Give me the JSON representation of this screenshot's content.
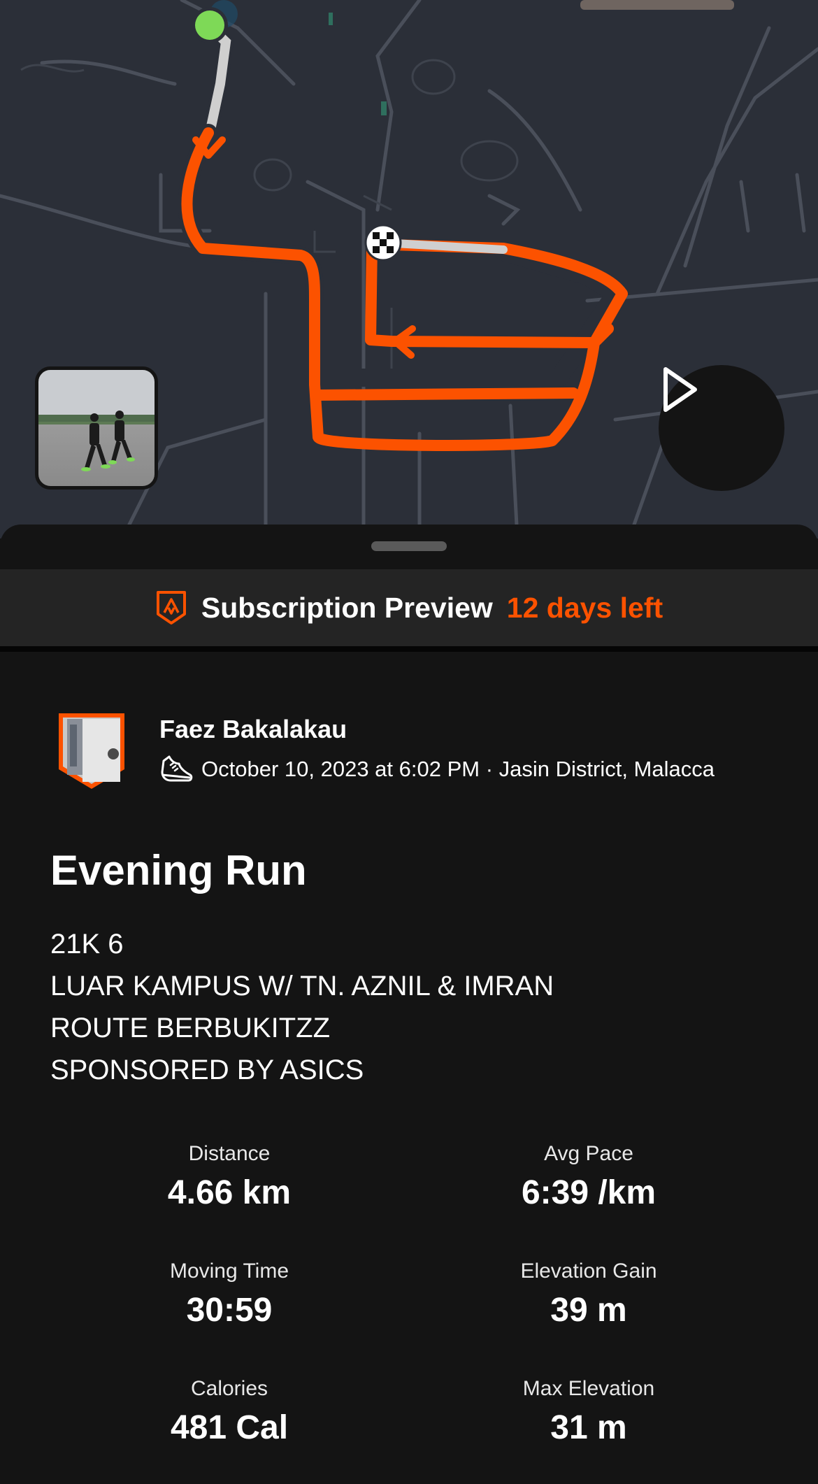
{
  "map": {
    "route_color": "#fc5200",
    "start_marker_color": "#7ed957",
    "start_marker": "start-dot-icon",
    "finish_marker": "checkered-flag-icon"
  },
  "play_button": {
    "icon": "play-icon"
  },
  "subscription": {
    "title": "Subscription Preview",
    "days_left": "12 days left",
    "accent": "#fc5200"
  },
  "athlete": {
    "name": "Faez Bakalakau",
    "meta": "October 10, 2023 at 6:02 PM · Jasin District, Malacca",
    "activity_icon": "running-shoe-icon"
  },
  "activity": {
    "title": "Evening Run",
    "description_lines": [
      "21K 6",
      "LUAR KAMPUS W/ TN. AZNIL & IMRAN",
      "ROUTE BERBUKITZZ",
      "SPONSORED BY ASICS"
    ]
  },
  "stats": [
    {
      "label": "Distance",
      "value": "4.66 km"
    },
    {
      "label": "Avg Pace",
      "value": "6:39 /km"
    },
    {
      "label": "Moving Time",
      "value": "30:59"
    },
    {
      "label": "Elevation Gain",
      "value": "39 m"
    },
    {
      "label": "Calories",
      "value": "481 Cal"
    },
    {
      "label": "Max Elevation",
      "value": "31 m"
    }
  ]
}
